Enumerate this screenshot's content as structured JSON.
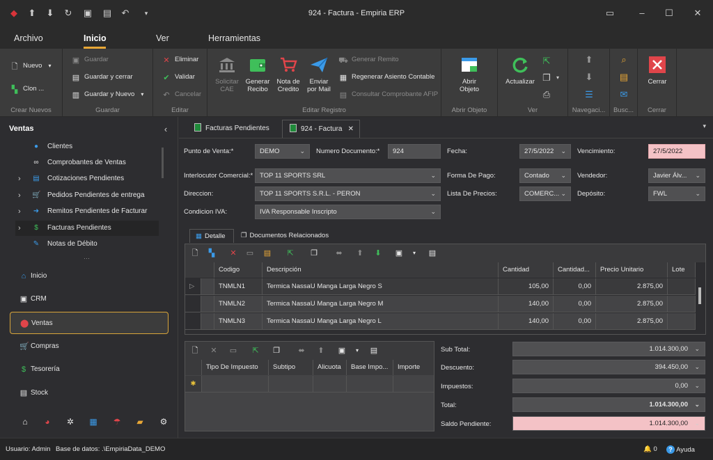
{
  "window": {
    "title": "924 - Factura - Empiria ERP"
  },
  "menu": {
    "archivo": "Archivo",
    "inicio": "Inicio",
    "ver": "Ver",
    "herramientas": "Herramientas"
  },
  "ribbon": {
    "nuevo": "Nuevo",
    "clon": "Clon ...",
    "g_crear": "Crear Nuevos",
    "guardar": "Guardar",
    "guardar_cerrar": "Guardar y cerrar",
    "guardar_nuevo": "Guardar y Nuevo",
    "g_guardar": "Guardar",
    "eliminar": "Eliminar",
    "validar": "Validar",
    "cancelar": "Cancelar",
    "g_editar": "Editar",
    "solicitar_1": "Solicitar",
    "solicitar_2": "CAE",
    "generar_1": "Generar",
    "generar_2": "Recibo",
    "nota_1": "Nota de",
    "nota_2": "Credito",
    "enviar_1": "Enviar",
    "enviar_2": "por Mail",
    "generar_remito": "Generar Remito",
    "regenerar_asiento": "Regenerar Asiento Contable",
    "consultar_comprobante": "Consultar Comprobante AFIP",
    "g_editar_registro": "Editar Registro",
    "abrir_1": "Abrir",
    "abrir_2": "Objeto",
    "g_abrir_objeto": "Abrir Objeto",
    "actualizar": "Actualizar",
    "g_ver": "Ver",
    "g_navegacion": "Navegaci...",
    "g_busc": "Busc...",
    "cerrar": "Cerrar",
    "g_cerrar": "Cerrar"
  },
  "sidebar": {
    "title": "Ventas",
    "tree": [
      "Clientes",
      "Comprobantes de Ventas",
      "Cotizaciones Pendientes",
      "Pedidos Pendientes de entrega",
      "Remitos Pendientes de Facturar",
      "Facturas Pendientes",
      "Notas de Débito"
    ],
    "nav": [
      "Inicio",
      "CRM",
      "Ventas",
      "Compras",
      "Tesorería",
      "Stock"
    ]
  },
  "tabs": {
    "facturas": "Facturas Pendientes",
    "factura": "924 - Factura"
  },
  "form": {
    "punto_venta_label": "Punto de Venta:*",
    "punto_venta": "DEMO",
    "numero_label": "Numero Documento:*",
    "numero": "924",
    "fecha_label": "Fecha:",
    "fecha": "27/5/2022",
    "vencimiento_label": "Vencimiento:",
    "vencimiento": "27/5/2022",
    "interlocutor_label": "Interlocutor Comercial:*",
    "interlocutor": "TOP 11 SPORTS SRL",
    "forma_pago_label": "Forma De Pago:",
    "forma_pago": "Contado",
    "vendedor_label": "Vendedor:",
    "vendedor": "Javier Álv...",
    "direccion_label": "Direccion:",
    "direccion": "TOP 11 SPORTS S.R.L. - PERON",
    "lista_precios_label": "Lista De Precios:",
    "lista_precios": "COMERC...",
    "deposito_label": "Depósito:",
    "deposito": "FWL",
    "condicion_label": "Condicion IVA:",
    "condicion": "IVA Responsable Inscripto"
  },
  "subtabs": {
    "detalle": "Detalle",
    "documentos": "Documentos Relacionados"
  },
  "detalle": {
    "columns": [
      "Codigo",
      "Descripción",
      "Cantidad",
      "Cantidad...",
      "Precio Unitario",
      "Lote"
    ],
    "rows": [
      {
        "codigo": "TNMLN1",
        "descripcion": "Termica NassaU Manga Larga Negro S",
        "cantidad": "105,00",
        "cantidad2": "0,00",
        "precio": "2.875,00"
      },
      {
        "codigo": "TNMLN2",
        "descripcion": "Termica NassaU Manga Larga Negro M",
        "cantidad": "140,00",
        "cantidad2": "0,00",
        "precio": "2.875,00"
      },
      {
        "codigo": "TNMLN3",
        "descripcion": "Termica NassaU Manga Larga Negro L",
        "cantidad": "140,00",
        "cantidad2": "0,00",
        "precio": "2.875,00"
      }
    ]
  },
  "impuestos": {
    "columns": [
      "Tipo De Impuesto",
      "Subtipo",
      "Alicuota",
      "Base Impo...",
      "Importe"
    ]
  },
  "totales": {
    "subtotal_label": "Sub Total:",
    "subtotal": "1.014.300,00",
    "descuento_label": "Descuento:",
    "descuento": "394.450,00",
    "impuestos_label": "Impuestos:",
    "impuestos": "0,00",
    "total_label": "Total:",
    "total": "1.014.300,00",
    "saldo_label": "Saldo Pendiente:",
    "saldo": "1.014.300,00"
  },
  "status": {
    "usuario": "Usuario: Admin",
    "base": "Base de datos: .\\EmpiriaData_DEMO",
    "notif_count": "0",
    "ayuda": "Ayuda"
  }
}
